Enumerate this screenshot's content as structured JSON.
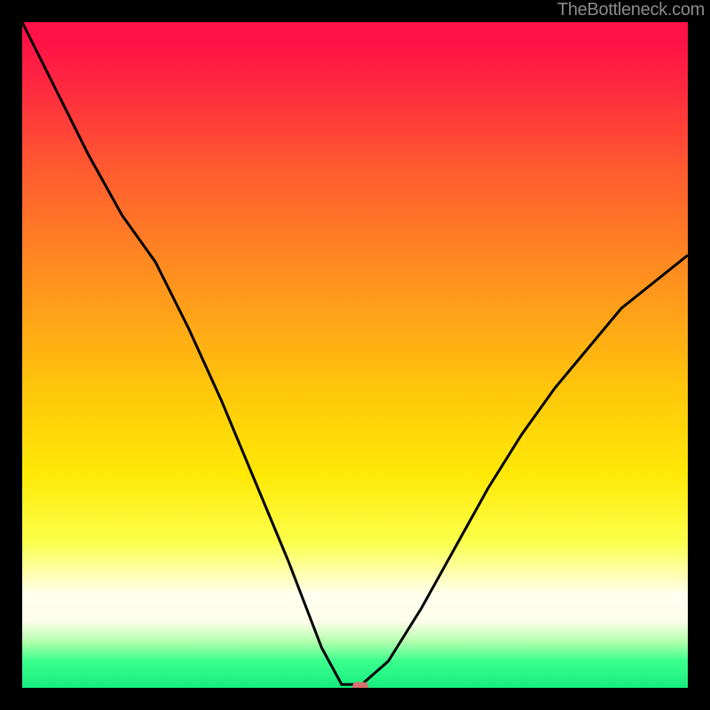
{
  "watermark": "TheBottleneck.com",
  "marker": {
    "x_frac": 0.508,
    "y_frac": 0.998
  },
  "chart_data": {
    "type": "line",
    "title": "",
    "xlabel": "",
    "ylabel": "",
    "xlim": [
      0,
      1
    ],
    "ylim": [
      0,
      1
    ],
    "note": "No axis ticks or numeric labels are visible; values are normalized 0–1 estimates read from the plot.",
    "series": [
      {
        "name": "curve",
        "x": [
          0.0,
          0.05,
          0.1,
          0.15,
          0.2,
          0.25,
          0.3,
          0.35,
          0.4,
          0.45,
          0.48,
          0.51,
          0.55,
          0.6,
          0.65,
          0.7,
          0.75,
          0.8,
          0.85,
          0.9,
          0.95,
          1.0
        ],
        "y": [
          1.0,
          0.9,
          0.8,
          0.71,
          0.64,
          0.54,
          0.43,
          0.31,
          0.19,
          0.06,
          0.005,
          0.005,
          0.04,
          0.12,
          0.21,
          0.3,
          0.38,
          0.45,
          0.51,
          0.57,
          0.61,
          0.65
        ]
      }
    ],
    "highlight_point": {
      "x": 0.508,
      "y": 0.002
    },
    "background_gradient": {
      "top": "#ff1247",
      "mid": "#ffe906",
      "bottom": "#17ed7f"
    }
  }
}
